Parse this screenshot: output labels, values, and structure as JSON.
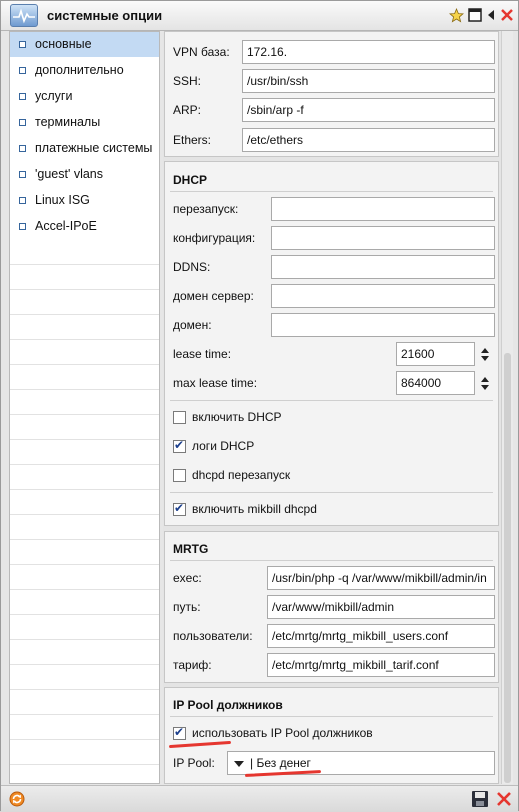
{
  "window": {
    "title": "системные опции"
  },
  "sidebar": {
    "items": [
      {
        "label": "основные",
        "active": true
      },
      {
        "label": "дополнительно"
      },
      {
        "label": "услуги"
      },
      {
        "label": "терминалы"
      },
      {
        "label": "платежные системы"
      },
      {
        "label": "'guest' vlans"
      },
      {
        "label": "Linux ISG"
      },
      {
        "label": "Accel-IPoE"
      }
    ]
  },
  "general": {
    "vpn_base_label": "VPN база:",
    "vpn_base_value": "172.16.",
    "ssh_label": "SSH:",
    "ssh_value": "/usr/bin/ssh",
    "arp_label": "ARP:",
    "arp_value": "/sbin/arp -f",
    "ethers_label": "Ethers:",
    "ethers_value": "/etc/ethers"
  },
  "dhcp": {
    "title": "DHCP",
    "restart_label": "перезапуск:",
    "restart_value": "",
    "config_label": "конфигурация:",
    "config_value": "",
    "ddns_label": "DDNS:",
    "ddns_value": "",
    "domain_server_label": "домен сервер:",
    "domain_server_value": "",
    "domain_label": "домен:",
    "domain_value": "",
    "lease_time_label": "lease time:",
    "lease_time_value": "21600",
    "max_lease_time_label": "max lease time:",
    "max_lease_time_value": "864000",
    "enable_dhcp_label": "включить DHCP",
    "enable_dhcp_checked": false,
    "logs_dhcp_label": "логи DHCP",
    "logs_dhcp_checked": true,
    "dhcpd_restart_label": "dhcpd перезапуск",
    "dhcpd_restart_checked": false,
    "enable_mikbill_dhcpd_label": "включить mikbill dhcpd",
    "enable_mikbill_dhcpd_checked": true
  },
  "mrtg": {
    "title": "MRTG",
    "exec_label": "exec:",
    "exec_value": "/usr/bin/php -q /var/www/mikbill/admin/in",
    "path_label": "путь:",
    "path_value": "/var/www/mikbill/admin",
    "users_label": "пользователи:",
    "users_value": "/etc/mrtg/mrtg_mikbill_users.conf",
    "tariff_label": "тариф:",
    "tariff_value": "/etc/mrtg/mrtg_mikbill_tarif.conf"
  },
  "ip_pool": {
    "title": "IP Pool должников",
    "use_label": "использовать IP Pool должников",
    "use_checked": true,
    "pool_label": "IP Pool:",
    "pool_selected": "| Без денег"
  },
  "colors": {
    "accent": "#c3daf3",
    "check": "#1c3f8c",
    "close": "#e5362f",
    "annotation": "#e5362f"
  }
}
